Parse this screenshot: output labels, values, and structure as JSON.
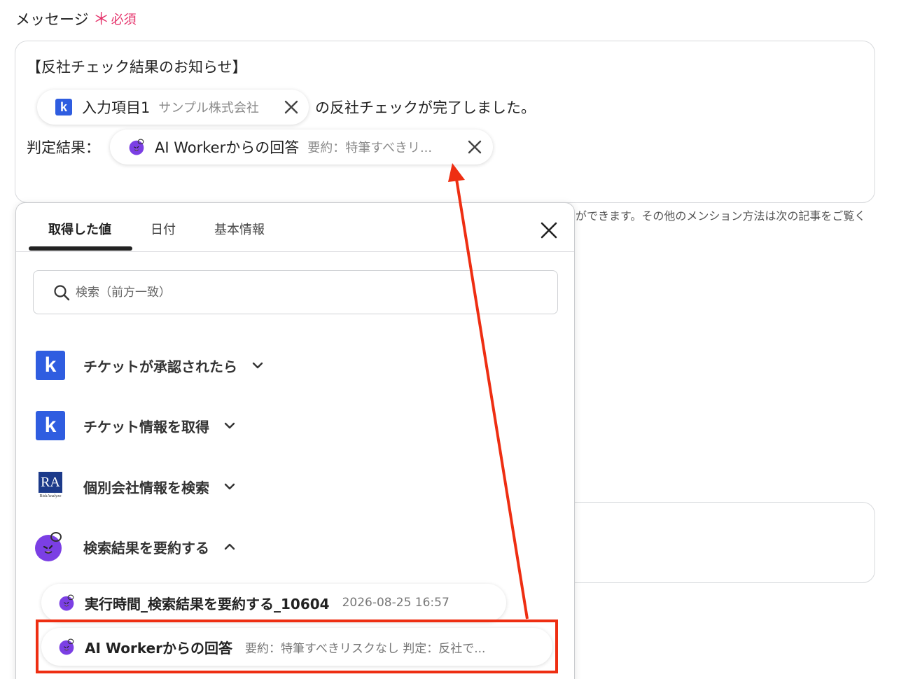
{
  "field": {
    "label": "メッセージ",
    "required_mark": "＊",
    "required_text": "必須"
  },
  "message": {
    "line1": "【反社チェック結果のお知らせ】",
    "chip1": {
      "label": "入力項目1",
      "value": "サンプル株式会社",
      "icon": "kintone-k-icon"
    },
    "line2_after": "の反社チェックが完了しました。",
    "line3_label": "判定結果：",
    "chip2": {
      "label": "AI Workerからの回答",
      "value": "要約：特筆すべきリ...",
      "icon": "ai-worker-icon"
    }
  },
  "hint_text": "ができます。その他のメンション方法は次の記事をご覧く",
  "panel": {
    "tabs": [
      {
        "label": "取得した値"
      },
      {
        "label": "日付"
      },
      {
        "label": "基本情報"
      }
    ],
    "search_placeholder": "検索（前方一致）",
    "groups": [
      {
        "label": "チケットが承認されたら",
        "icon": "kintone-k-icon",
        "expanded": false
      },
      {
        "label": "チケット情報を取得",
        "icon": "kintone-k-icon",
        "expanded": false
      },
      {
        "label": "個別会社情報を検索",
        "icon": "riskanalyze-logo",
        "expanded": false
      },
      {
        "label": "検索結果を要約する",
        "icon": "ai-worker-icon",
        "expanded": true
      }
    ],
    "ra_logo": {
      "mark": "RA",
      "sub": "RiskAnalyze"
    },
    "items": [
      {
        "label": "実行時間_検索結果を要約する_10604",
        "value": "2026-08-25 16:57"
      },
      {
        "label": "AI Workerからの回答",
        "value": "要約：特筆すべきリスクなし 判定：反社で..."
      }
    ]
  },
  "colors": {
    "required": "#e5336b",
    "kintone_blue": "#2f5de0",
    "ai_purple": "#7b3fe4",
    "highlight_red": "#ee2e12"
  }
}
